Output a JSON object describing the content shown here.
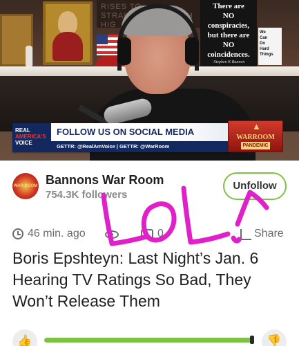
{
  "video": {
    "sign_black": {
      "lines": [
        "There are",
        "NO",
        "conspiracies,",
        "but there are",
        "NO",
        "coincidences."
      ],
      "signature": "-Stephen K Bannon"
    },
    "sign_white": {
      "lines": [
        "We",
        "Can",
        "Do",
        "Hard",
        "Things"
      ]
    },
    "sign_back": "RISES TO ... STRAIGHT ... EAI ... H HIG",
    "banner": {
      "logo_line1": "REAL",
      "logo_line2": "AMERICA'S",
      "logo_line3": "VOICE",
      "headline": "FOLLOW US ON SOCIAL MEDIA",
      "subline": "GETTR: @RealAmVoice | GETTR: @WarRoom"
    },
    "badge": {
      "title": "WARROOM",
      "sub": "PANDEMIC"
    }
  },
  "channel": {
    "name": "Bannons War Room",
    "followers": "754.3K followers",
    "avatar_text": "WAR ROOM",
    "follow_button": "Unfollow"
  },
  "meta": {
    "time": "46 min. ago",
    "comment_count": "0",
    "share_label": "Share"
  },
  "post": {
    "headline": "Boris Epshteyn: Last Night’s Jan. 6 Hearing TV Ratings So Bad, They Won’t Release Them"
  },
  "votes": {
    "like_fraction": 0.99
  },
  "overlay": {
    "scrawl_text": "LOL!",
    "scrawl_color": "#e020c8"
  },
  "colors": {
    "accent_green": "#7cc243",
    "banner_navy": "#12285e",
    "warroom_red": "#d23a2a"
  }
}
